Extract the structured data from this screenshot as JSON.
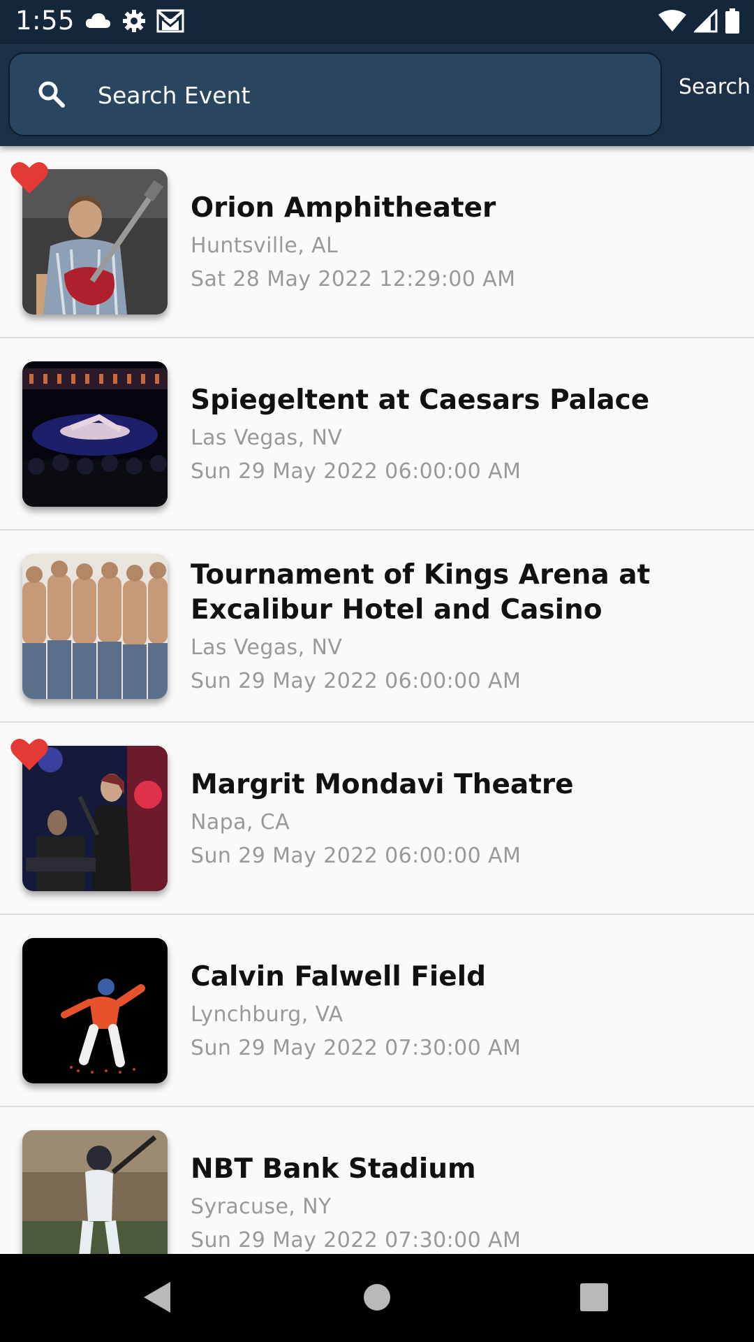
{
  "status_bar": {
    "time": "1:55",
    "left_icons": [
      "cloud-icon",
      "gear-icon",
      "gmail-icon"
    ],
    "right_icons": [
      "wifi-icon",
      "signal-icon",
      "battery-icon"
    ]
  },
  "search": {
    "placeholder": "Search Event",
    "value": "",
    "action_label": "Search"
  },
  "events": [
    {
      "title": "Orion Amphitheater",
      "location": "Huntsville, AL",
      "date": "Sat 28 May 2022 12:29:00 AM",
      "favorite": true
    },
    {
      "title": "Spiegeltent at Caesars Palace",
      "location": "Las Vegas, NV",
      "date": "Sun 29 May 2022 06:00:00 AM",
      "favorite": false
    },
    {
      "title": "Tournament of Kings Arena at Excalibur Hotel and Casino",
      "location": "Las Vegas, NV",
      "date": "Sun 29 May 2022 06:00:00 AM",
      "favorite": false
    },
    {
      "title": "Margrit Mondavi Theatre",
      "location": "Napa, CA",
      "date": "Sun 29 May 2022 06:00:00 AM",
      "favorite": true
    },
    {
      "title": "Calvin Falwell Field",
      "location": "Lynchburg, VA",
      "date": "Sun 29 May 2022 07:30:00 AM",
      "favorite": false
    },
    {
      "title": "NBT Bank Stadium",
      "location": "Syracuse, NY",
      "date": "Sun 29 May 2022 07:30:00 AM",
      "favorite": false
    }
  ],
  "colors": {
    "header_bg": "#1b3047",
    "status_bg": "#14263a",
    "favorite": "#e53935"
  },
  "nav_bar": [
    "back-icon",
    "home-icon",
    "recents-icon"
  ]
}
